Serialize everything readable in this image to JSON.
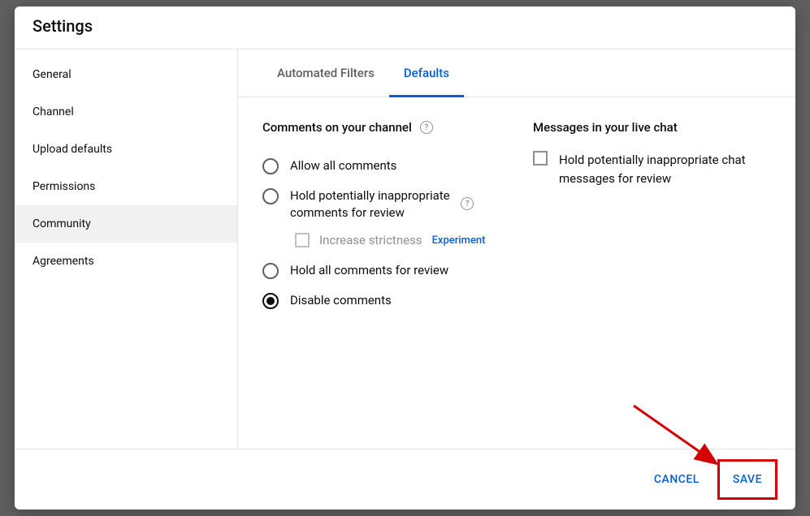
{
  "dialog": {
    "title": "Settings"
  },
  "sidebar": {
    "items": [
      {
        "label": "General",
        "selected": false
      },
      {
        "label": "Channel",
        "selected": false
      },
      {
        "label": "Upload defaults",
        "selected": false
      },
      {
        "label": "Permissions",
        "selected": false
      },
      {
        "label": "Community",
        "selected": true
      },
      {
        "label": "Agreements",
        "selected": false
      }
    ]
  },
  "tabs": [
    {
      "label": "Automated Filters",
      "active": false
    },
    {
      "label": "Defaults",
      "active": true
    }
  ],
  "comments": {
    "heading": "Comments on your channel",
    "options": [
      {
        "label": "Allow all comments",
        "selected": false
      },
      {
        "label": "Hold potentially inappropriate comments for review",
        "selected": false,
        "has_help": true
      },
      {
        "label": "Hold all comments for review",
        "selected": false
      },
      {
        "label": "Disable comments",
        "selected": true
      }
    ],
    "strictness": {
      "label": "Increase strictness",
      "badge": "Experiment"
    }
  },
  "livechat": {
    "heading": "Messages in your live chat",
    "option": {
      "label": "Hold potentially inappropriate chat messages for review",
      "checked": false
    }
  },
  "footer": {
    "cancel": "CANCEL",
    "save": "SAVE"
  }
}
